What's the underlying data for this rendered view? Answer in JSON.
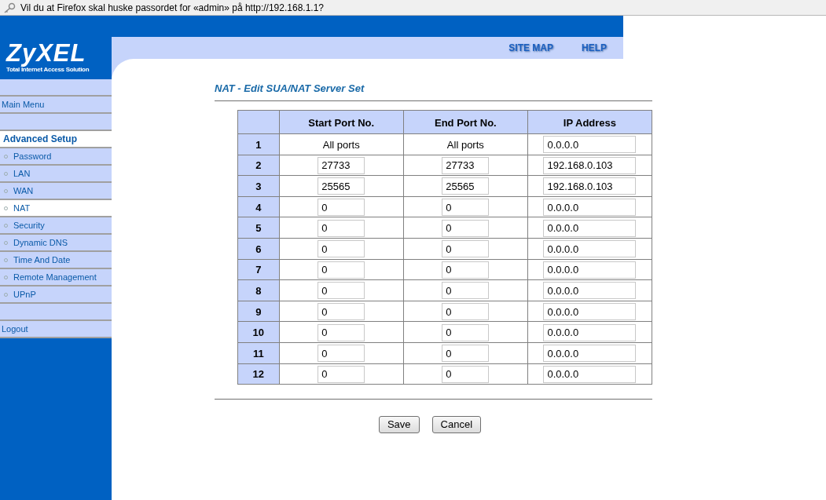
{
  "notification": {
    "text": "Vil du at Firefox skal huske passordet for «admin» på http://192.168.1.1?"
  },
  "logo": {
    "brand": "ZyXEL",
    "tagline": "Total Internet Access Solution"
  },
  "top_links": [
    "SITE MAP",
    "HELP"
  ],
  "sidebar": {
    "items": [
      {
        "kind": "gap"
      },
      {
        "kind": "link",
        "label": "Main Menu"
      },
      {
        "kind": "gap"
      },
      {
        "kind": "heading",
        "label": "Advanced Setup"
      },
      {
        "kind": "sub",
        "label": "Password",
        "selected": false
      },
      {
        "kind": "sub",
        "label": "LAN",
        "selected": false
      },
      {
        "kind": "sub",
        "label": "WAN",
        "selected": false
      },
      {
        "kind": "sub",
        "label": "NAT",
        "selected": true
      },
      {
        "kind": "sub",
        "label": "Security",
        "selected": false
      },
      {
        "kind": "sub",
        "label": "Dynamic DNS",
        "selected": false
      },
      {
        "kind": "sub",
        "label": "Time And Date",
        "selected": false
      },
      {
        "kind": "sub",
        "label": "Remote Management",
        "selected": false
      },
      {
        "kind": "sub",
        "label": "UPnP",
        "selected": false
      },
      {
        "kind": "gap"
      },
      {
        "kind": "link",
        "label": "Logout"
      }
    ]
  },
  "page_title": "NAT - Edit SUA/NAT Server Set",
  "table": {
    "columns": [
      "Start Port No.",
      "End Port No.",
      "IP Address"
    ],
    "rows": [
      {
        "index": "1",
        "start": {
          "kind": "text",
          "value": "All ports"
        },
        "end": {
          "kind": "text",
          "value": "All ports"
        },
        "ip": "0.0.0.0"
      },
      {
        "index": "2",
        "start": {
          "kind": "input",
          "value": "27733"
        },
        "end": {
          "kind": "input",
          "value": "27733"
        },
        "ip": "192.168.0.103"
      },
      {
        "index": "3",
        "start": {
          "kind": "input",
          "value": "25565"
        },
        "end": {
          "kind": "input",
          "value": "25565"
        },
        "ip": "192.168.0.103"
      },
      {
        "index": "4",
        "start": {
          "kind": "input",
          "value": "0"
        },
        "end": {
          "kind": "input",
          "value": "0"
        },
        "ip": "0.0.0.0"
      },
      {
        "index": "5",
        "start": {
          "kind": "input",
          "value": "0"
        },
        "end": {
          "kind": "input",
          "value": "0"
        },
        "ip": "0.0.0.0"
      },
      {
        "index": "6",
        "start": {
          "kind": "input",
          "value": "0"
        },
        "end": {
          "kind": "input",
          "value": "0"
        },
        "ip": "0.0.0.0"
      },
      {
        "index": "7",
        "start": {
          "kind": "input",
          "value": "0"
        },
        "end": {
          "kind": "input",
          "value": "0"
        },
        "ip": "0.0.0.0"
      },
      {
        "index": "8",
        "start": {
          "kind": "input",
          "value": "0"
        },
        "end": {
          "kind": "input",
          "value": "0"
        },
        "ip": "0.0.0.0"
      },
      {
        "index": "9",
        "start": {
          "kind": "input",
          "value": "0"
        },
        "end": {
          "kind": "input",
          "value": "0"
        },
        "ip": "0.0.0.0"
      },
      {
        "index": "10",
        "start": {
          "kind": "input",
          "value": "0"
        },
        "end": {
          "kind": "input",
          "value": "0"
        },
        "ip": "0.0.0.0"
      },
      {
        "index": "11",
        "start": {
          "kind": "input",
          "value": "0"
        },
        "end": {
          "kind": "input",
          "value": "0"
        },
        "ip": "0.0.0.0"
      },
      {
        "index": "12",
        "start": {
          "kind": "input",
          "value": "0"
        },
        "end": {
          "kind": "input",
          "value": "0"
        },
        "ip": "0.0.0.0"
      }
    ]
  },
  "buttons": [
    "Save",
    "Cancel"
  ]
}
